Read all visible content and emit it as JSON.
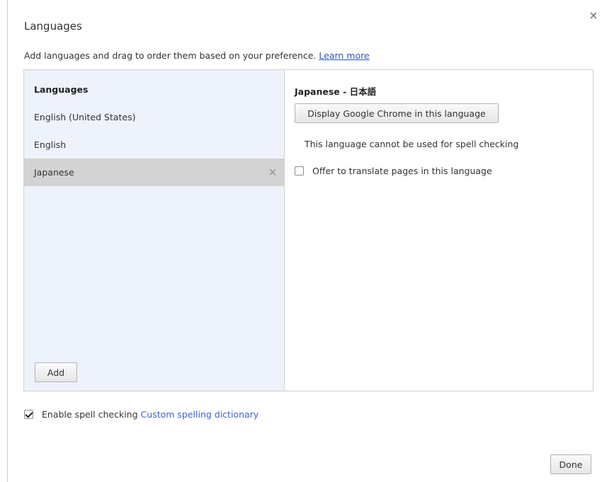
{
  "dialog": {
    "title": "Languages",
    "close_label": "×",
    "subtitle": "Add languages and drag to order them based on your preference.",
    "learn_more": "Learn more"
  },
  "language_list": {
    "header": "Languages",
    "items": [
      {
        "label": "English (United States)",
        "selected": false
      },
      {
        "label": "English",
        "selected": false
      },
      {
        "label": "Japanese",
        "selected": true
      }
    ],
    "remove_label": "×",
    "add_label": "Add"
  },
  "detail": {
    "title": "Japanese - 日本語",
    "display_button": "Display Google Chrome in this language",
    "spell_note": "This language cannot be used for spell checking",
    "translate_label": "Offer to translate pages in this language",
    "translate_checked": false
  },
  "footer": {
    "spell_label": "Enable spell checking",
    "spell_checked": true,
    "dictionary_link": "Custom spelling dictionary",
    "done_label": "Done"
  },
  "colors": {
    "accent": "#4a6fd8",
    "list_background": "#eef2fb",
    "selected_row": "#d3d3d3",
    "link": "#2a55c9"
  }
}
